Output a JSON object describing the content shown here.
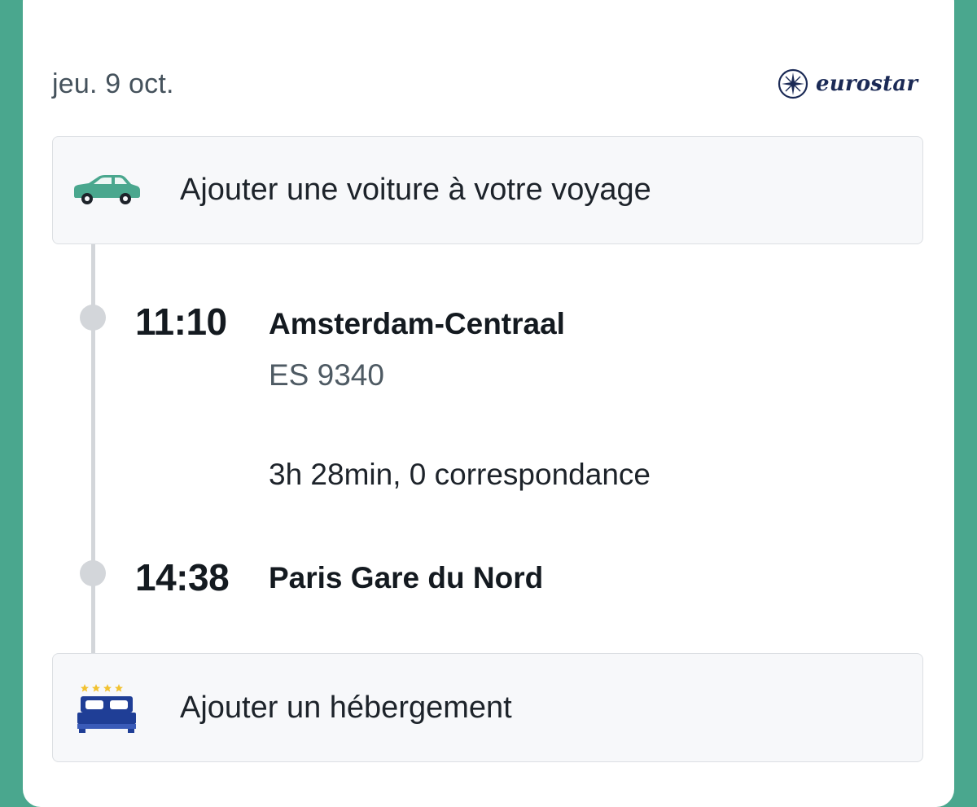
{
  "trip": {
    "date": "jeu. 9 oct.",
    "operator_logo_text": "eurostar",
    "add_car_label": "Ajouter une voiture à votre voyage",
    "departure": {
      "time": "11:10",
      "station": "Amsterdam-Centraal"
    },
    "train_number": "ES 9340",
    "duration_summary": "3h 28min, 0 correspondance",
    "arrival": {
      "time": "14:38",
      "station": "Paris Gare du Nord"
    },
    "add_hotel_label": "Ajouter un hébergement"
  },
  "icons": {
    "car": "car-icon",
    "hotel": "hotel-bed-icon",
    "logo": "eurostar-star-icon"
  },
  "colors": {
    "background": "#4aa78e",
    "car_icon": "#4aa78e",
    "hotel_icon": "#1f3e96",
    "hotel_stars": "#f2c230",
    "logo": "#1b2a56"
  }
}
